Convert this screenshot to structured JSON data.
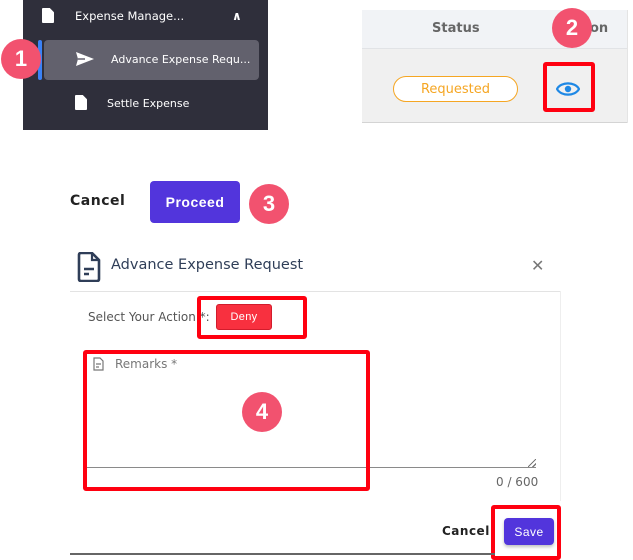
{
  "sidebar": {
    "group": {
      "label": "Expense Manage...",
      "icon": "file-icon",
      "expanded": true
    },
    "items": [
      {
        "label": "Advance Expense Requ...",
        "icon": "send-icon",
        "active": true
      },
      {
        "label": "Settle Expense",
        "icon": "file-icon",
        "active": false
      }
    ]
  },
  "steps": [
    "1",
    "2",
    "3",
    "4"
  ],
  "table": {
    "headers": {
      "status": "Status",
      "action": "on"
    },
    "row": {
      "status": "Requested",
      "action_icon": "eye-icon"
    }
  },
  "confirm_bar": {
    "cancel_label": "Cancel",
    "proceed_label": "Proceed"
  },
  "dialog": {
    "title": "Advance Expense Request",
    "icon": "document-icon",
    "close_icon": "close-icon",
    "action_label": "Select Your Action *:",
    "action_value": "Deny",
    "remarks_label": "Remarks *",
    "remarks_value": "",
    "char_counter": "0 / 600",
    "cancel_label": "Cancel",
    "save_label": "Save"
  },
  "colors": {
    "accent": "#5235dc",
    "sidebar_bg": "#2f2f3b",
    "step_badge": "#f2526f",
    "highlight": "#ff0010",
    "status_requested": "#f5a623",
    "deny": "#f8303f",
    "link_blue": "#1e88e5"
  }
}
